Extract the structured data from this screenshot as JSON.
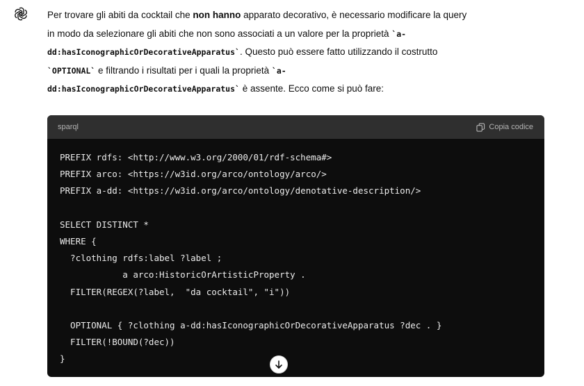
{
  "assistant": {
    "icon": "openai-logo-icon"
  },
  "message": {
    "line1_a": "Per trovare gli abiti da cocktail che ",
    "line1_bold": "non hanno",
    "line1_b": " apparato decorativo, è necessario modificare la query",
    "line2_a": "in modo da selezionare gli abiti che non sono associati a un valore per la proprietà ",
    "line2_code": "`a-",
    "line3_code": "dd:hasIconographicOrDecorativeApparatus`",
    "line3_b": ". Questo può essere fatto utilizzando il costrutto",
    "line4_code": "`OPTIONAL`",
    "line4_b": " e filtrando i risultati per i quali la proprietà ",
    "line4_code2": "`a-",
    "line5_code": "dd:hasIconographicOrDecorativeApparatus`",
    "line5_b": " è assente. Ecco come si può fare:"
  },
  "codeblock": {
    "language": "sparql",
    "copy_label": "Copia codice",
    "lines": [
      "PREFIX rdfs: <http://www.w3.org/2000/01/rdf-schema#>",
      "PREFIX arco: <https://w3id.org/arco/ontology/arco/>",
      "PREFIX a-dd: <https://w3id.org/arco/ontology/denotative-description/>",
      "",
      "SELECT DISTINCT *",
      "WHERE {",
      "  ?clothing rdfs:label ?label ;",
      "            a arco:HistoricOrArtisticProperty .",
      "  FILTER(REGEX(?label,  \"da cocktail\", \"i\"))",
      "",
      "  OPTIONAL { ?clothing a-dd:hasIconographicOrDecorativeApparatus ?dec . }",
      "  FILTER(!BOUND(?dec))",
      "}"
    ]
  },
  "scroll_button": {
    "icon": "arrow-down-icon"
  }
}
